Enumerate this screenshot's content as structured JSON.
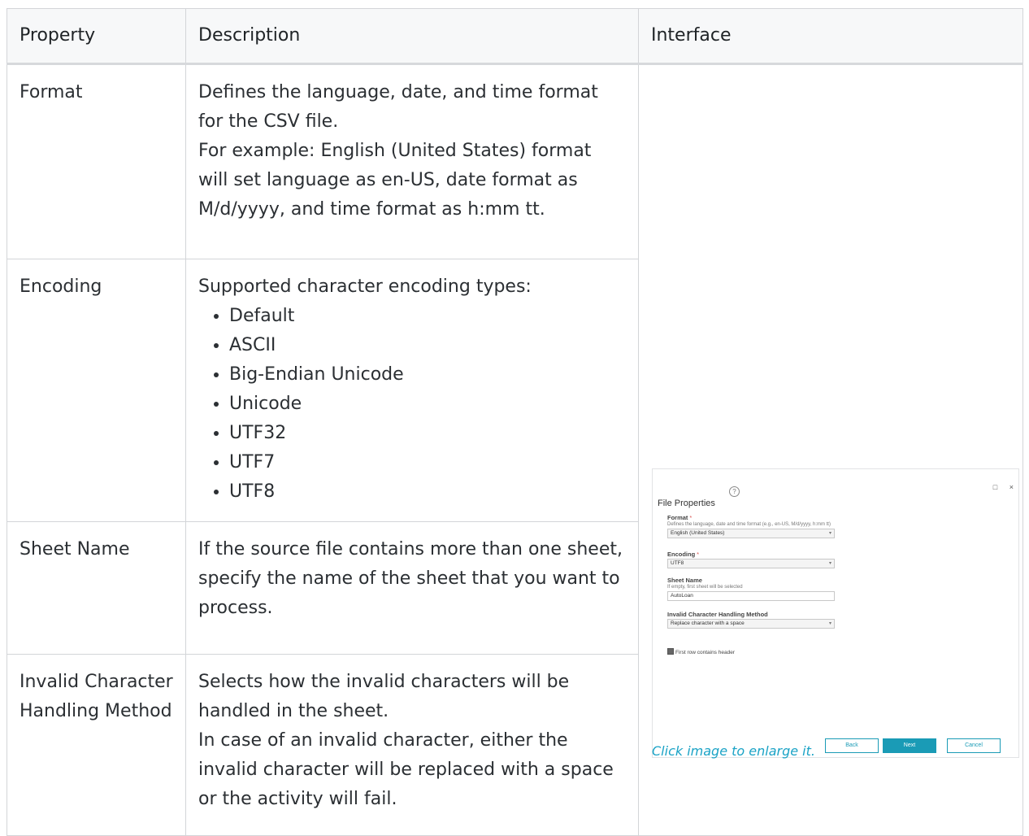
{
  "table": {
    "headers": [
      "Property",
      "Description",
      "Interface"
    ],
    "rows": [
      {
        "property": "Format",
        "description": [
          "Defines the language, date, and time format for the CSV file.",
          "For example: English (United States) format will set language as en-US, date format as M/d/yyyy, and time format as h:mm tt."
        ]
      },
      {
        "property": "Encoding",
        "description_intro": "Supported character encoding types:",
        "encoding_types": [
          "Default",
          "ASCII",
          "Big-Endian Unicode",
          "Unicode",
          "UTF32",
          "UTF7",
          "UTF8"
        ]
      },
      {
        "property": "Sheet Name",
        "description": "If the source file contains more than one sheet, specify the name of the sheet that you want to process."
      },
      {
        "property": "Invalid Character Handling Method",
        "description": [
          "Selects how the invalid characters will be handled in the sheet.",
          "In case of an invalid character, either the invalid character will be replaced with a space or the activity will fail."
        ]
      }
    ]
  },
  "interface": {
    "caption": "Click image to enlarge it.",
    "window_controls": [
      "□",
      "×"
    ],
    "dialog_title": "File Properties",
    "help_icon": "question-icon",
    "format": {
      "label": "Format",
      "required_mark": "*",
      "help": "Defines the language, date and time format (e.g., en-US, M/d/yyyy, h:mm tt)",
      "value": "English (United States)"
    },
    "encoding": {
      "label": "Encoding",
      "required_mark": "*",
      "value": "UTF8"
    },
    "sheet_name": {
      "label": "Sheet Name",
      "help": "If empty, first sheet will be selected",
      "value": "AutoLoan"
    },
    "invalid_char": {
      "label": "Invalid Character Handling Method",
      "value": "Replace character with a space"
    },
    "checkbox": {
      "label": "First row contains header",
      "checked": true
    },
    "buttons": {
      "back": "Back",
      "next": "Next",
      "cancel": "Cancel"
    },
    "colors": {
      "accent": "#1a9bb6",
      "caption": "#1ba3c6"
    }
  }
}
